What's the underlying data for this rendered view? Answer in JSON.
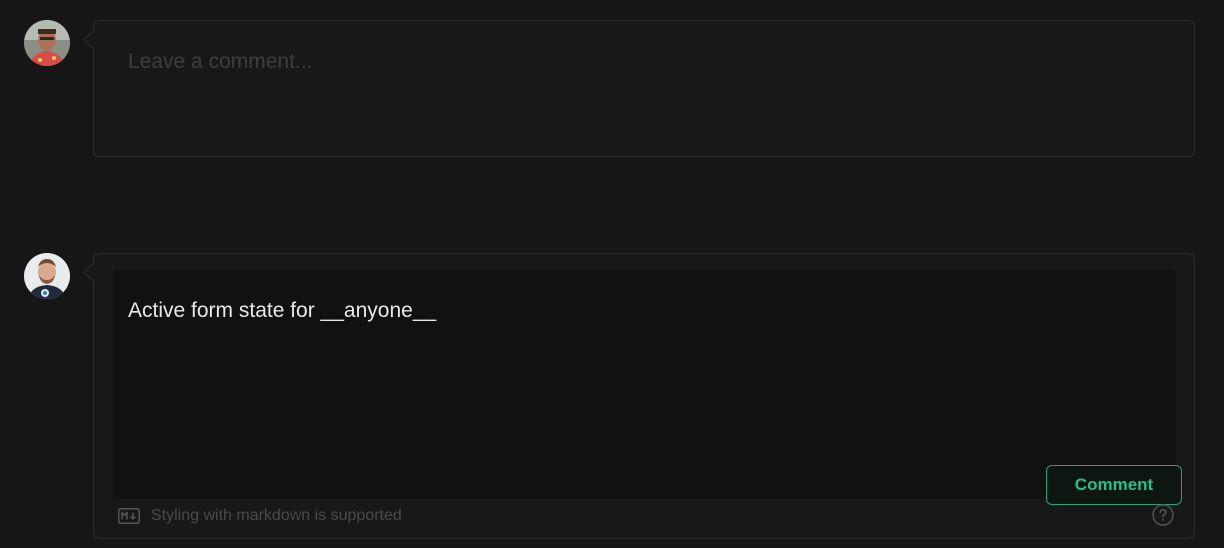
{
  "new_comment": {
    "placeholder": "Leave a comment..."
  },
  "active_comment": {
    "text": "Active form state for __anyone__",
    "submit_label": "Comment",
    "footer_hint": "Styling with markdown is supported",
    "icons": [
      "markdown-icon",
      "help-icon"
    ]
  },
  "colors": {
    "background": "#161616",
    "box_border": "#2c2c2c",
    "accent": "#24c08d"
  }
}
